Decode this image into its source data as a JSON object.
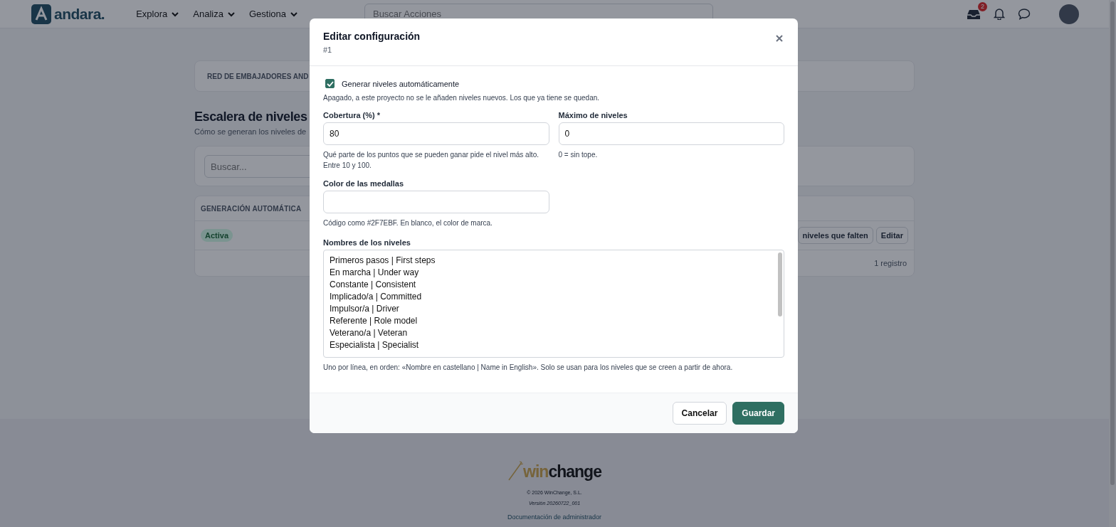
{
  "nav": {
    "logo": "andara.",
    "menus": [
      {
        "label": "Explora"
      },
      {
        "label": "Analiza"
      },
      {
        "label": "Gestiona"
      }
    ],
    "search_placeholder": "Buscar Acciones",
    "inbox_badge": "2"
  },
  "page": {
    "project": "RED DE EMBAJADORES AND",
    "title": "Escalera de niveles",
    "subtitle": "Cómo se generan los niveles de",
    "search_placeholder": "Buscar...",
    "table": {
      "columns": [
        "GENERACIÓN AUTOMÁTICA"
      ],
      "rows": [
        {
          "status": "Activa",
          "actions": [
            "niveles que falten",
            "Editar"
          ]
        }
      ],
      "count": "1 registro"
    }
  },
  "modal": {
    "title": "Editar configuración",
    "subtitle": "#1",
    "auto": {
      "label": "Generar niveles automáticamente",
      "checked": true,
      "help": "Apagado, a este proyecto no se le añaden niveles nuevos. Los que ya tiene se quedan."
    },
    "coverage": {
      "label": "Cobertura (%) *",
      "value": "80",
      "help": "Qué parte de los puntos que se pueden ganar pide el nivel más alto. Entre 10 y 100."
    },
    "max_levels": {
      "label": "Máximo de niveles",
      "value": "0",
      "help": "0 = sin tope."
    },
    "medal_color": {
      "label": "Color de las medallas",
      "help": "Código como #2F7EBF. En blanco, el color de marca."
    },
    "level_names": {
      "label": "Nombres de los niveles",
      "lines": [
        "Primeros pasos | First steps",
        "En marcha | Under way",
        "Constante | Consistent",
        "Implicado/a | Committed",
        "Impulsor/a | Driver",
        "Referente | Role model",
        "Veterano/a | Veteran",
        "Especialista | Specialist"
      ],
      "help": "Uno por línea, en orden: «Nombre en castellano | Name in English». Solo se usan para los niveles que se creen a partir de ahora."
    },
    "buttons": {
      "cancel": "Cancelar",
      "save": "Guardar"
    }
  },
  "footer": {
    "logo_win": "win",
    "logo_change": "change",
    "copyright": "© 2026 WinChange, S.L.",
    "version": "Versión 20260722_001",
    "docs": "Documentación de administrador"
  }
}
